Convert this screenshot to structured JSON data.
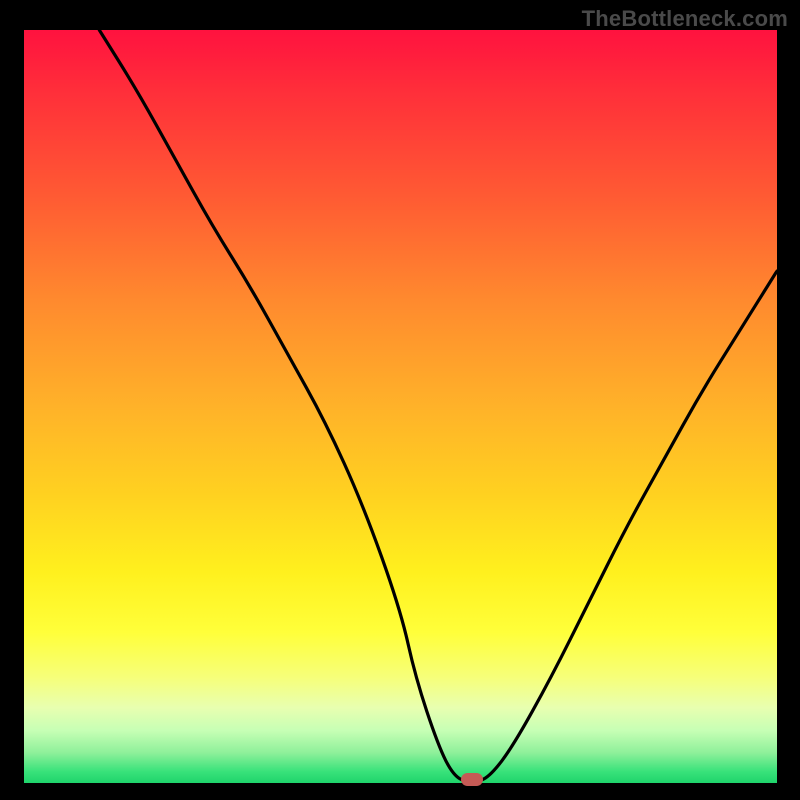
{
  "watermark": "TheBottleneck.com",
  "colors": {
    "curve": "#000000",
    "marker": "#c55a55",
    "gradient_stops": [
      "#ff123f",
      "#ff2e3a",
      "#ff5a33",
      "#ff8a2e",
      "#ffb229",
      "#ffd220",
      "#fff01e",
      "#ffff3a",
      "#f6ff7a",
      "#e8ffb0",
      "#c7ffb5",
      "#8ef09a",
      "#38e27a",
      "#1fd46b"
    ]
  },
  "chart_data": {
    "type": "line",
    "title": "",
    "xlabel": "",
    "ylabel": "",
    "xlim": [
      0,
      100
    ],
    "ylim": [
      0,
      100
    ],
    "grid": false,
    "legend": false,
    "series": [
      {
        "name": "bottleneck-curve",
        "x": [
          10,
          15,
          20,
          25,
          30,
          35,
          40,
          45,
          50,
          52,
          55,
          57,
          59,
          60,
          62,
          65,
          70,
          75,
          80,
          85,
          90,
          95,
          100
        ],
        "y": [
          100,
          92,
          83,
          74,
          66,
          57,
          48,
          37,
          23,
          14,
          5,
          1,
          0,
          0,
          1,
          5,
          14,
          24,
          34,
          43,
          52,
          60,
          68
        ]
      }
    ],
    "marker": {
      "x": 59.5,
      "y": 0,
      "shape": "pill",
      "color": "#c55a55"
    },
    "note": "Values are approximate, read from the unlabeled plot by proportion of plot area; x and y are percentages of axis span."
  }
}
